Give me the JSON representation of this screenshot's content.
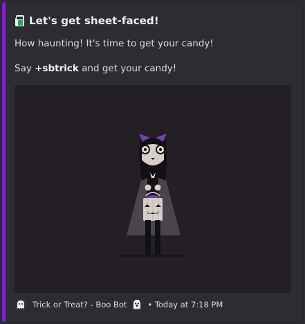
{
  "embed": {
    "accent_color": "#8a15e6",
    "title": "Let's get sheet-faced!",
    "title_icon": "ghost-sheet-icon",
    "description_line1": "How haunting! It's time to get your candy!",
    "description_line2_prefix": "Say ",
    "description_command": "+sbtrick",
    "description_line2_suffix": " and get your candy!",
    "image_name": "vampire-kid-with-pumpkin-basket"
  },
  "footer": {
    "icon": "ghost-icon",
    "text": "Trick or Treat? - Boo Bot",
    "ghost_emoji": "ghost-emoji-icon",
    "timestamp": "• Today at 7:18 PM"
  }
}
